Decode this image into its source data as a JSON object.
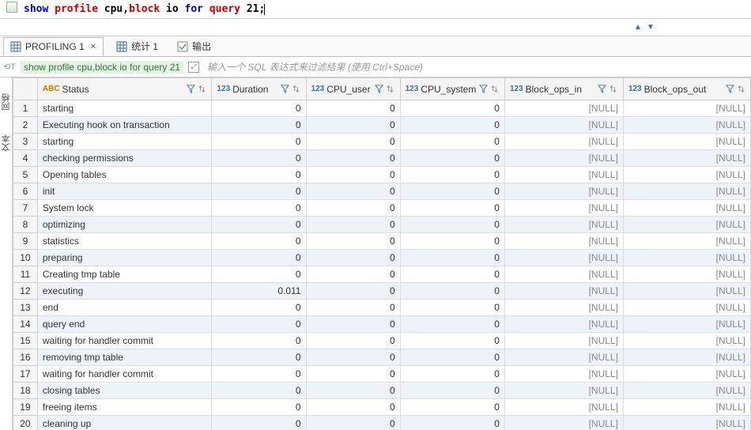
{
  "sql": {
    "text_parts": {
      "show": "show",
      "profile": "profile",
      "cpu": "cpu",
      "comma": ",",
      "block": "block",
      "io": "io",
      "for": "for",
      "query": "query",
      "num": "21",
      "semi": ";"
    }
  },
  "tabs": {
    "items": [
      {
        "label": "PROFILING 1",
        "active": true,
        "closable": true,
        "icon": "grid"
      },
      {
        "label": "统计 1",
        "active": false,
        "closable": false,
        "icon": "grid"
      },
      {
        "label": "输出",
        "active": false,
        "closable": false,
        "icon": "green"
      }
    ]
  },
  "filter": {
    "sql_text": "show profile cpu,block io for query 21",
    "placeholder": "输入一个 SQL 表达式来过滤结果 (使用 Ctrl+Space)"
  },
  "gutter": {
    "top": "网格",
    "bottom": "文本"
  },
  "columns": [
    {
      "name": "Status",
      "type": "ABC"
    },
    {
      "name": "Duration",
      "type": "123"
    },
    {
      "name": "CPU_user",
      "type": "123"
    },
    {
      "name": "CPU_system",
      "type": "123"
    },
    {
      "name": "Block_ops_in",
      "type": "123"
    },
    {
      "name": "Block_ops_out",
      "type": "123"
    }
  ],
  "nullText": "[NULL]",
  "rows": [
    {
      "n": 1,
      "status": "starting",
      "dur": "0",
      "cpuu": "0",
      "cpus": "0",
      "bin": null,
      "bout": null
    },
    {
      "n": 2,
      "status": "Executing hook on transaction",
      "dur": "0",
      "cpuu": "0",
      "cpus": "0",
      "bin": null,
      "bout": null
    },
    {
      "n": 3,
      "status": "starting",
      "dur": "0",
      "cpuu": "0",
      "cpus": "0",
      "bin": null,
      "bout": null
    },
    {
      "n": 4,
      "status": "checking permissions",
      "dur": "0",
      "cpuu": "0",
      "cpus": "0",
      "bin": null,
      "bout": null
    },
    {
      "n": 5,
      "status": "Opening tables",
      "dur": "0",
      "cpuu": "0",
      "cpus": "0",
      "bin": null,
      "bout": null
    },
    {
      "n": 6,
      "status": "init",
      "dur": "0",
      "cpuu": "0",
      "cpus": "0",
      "bin": null,
      "bout": null
    },
    {
      "n": 7,
      "status": "System lock",
      "dur": "0",
      "cpuu": "0",
      "cpus": "0",
      "bin": null,
      "bout": null
    },
    {
      "n": 8,
      "status": "optimizing",
      "dur": "0",
      "cpuu": "0",
      "cpus": "0",
      "bin": null,
      "bout": null
    },
    {
      "n": 9,
      "status": "statistics",
      "dur": "0",
      "cpuu": "0",
      "cpus": "0",
      "bin": null,
      "bout": null
    },
    {
      "n": 10,
      "status": "preparing",
      "dur": "0",
      "cpuu": "0",
      "cpus": "0",
      "bin": null,
      "bout": null
    },
    {
      "n": 11,
      "status": "Creating tmp table",
      "dur": "0",
      "cpuu": "0",
      "cpus": "0",
      "bin": null,
      "bout": null
    },
    {
      "n": 12,
      "status": "executing",
      "dur": "0.011",
      "cpuu": "0",
      "cpus": "0",
      "bin": null,
      "bout": null
    },
    {
      "n": 13,
      "status": "end",
      "dur": "0",
      "cpuu": "0",
      "cpus": "0",
      "bin": null,
      "bout": null
    },
    {
      "n": 14,
      "status": "query end",
      "dur": "0",
      "cpuu": "0",
      "cpus": "0",
      "bin": null,
      "bout": null
    },
    {
      "n": 15,
      "status": "waiting for handler commit",
      "dur": "0",
      "cpuu": "0",
      "cpus": "0",
      "bin": null,
      "bout": null
    },
    {
      "n": 16,
      "status": "removing tmp table",
      "dur": "0",
      "cpuu": "0",
      "cpus": "0",
      "bin": null,
      "bout": null
    },
    {
      "n": 17,
      "status": "waiting for handler commit",
      "dur": "0",
      "cpuu": "0",
      "cpus": "0",
      "bin": null,
      "bout": null
    },
    {
      "n": 18,
      "status": "closing tables",
      "dur": "0",
      "cpuu": "0",
      "cpus": "0",
      "bin": null,
      "bout": null
    },
    {
      "n": 19,
      "status": "freeing items",
      "dur": "0",
      "cpuu": "0",
      "cpus": "0",
      "bin": null,
      "bout": null
    },
    {
      "n": 20,
      "status": "cleaning up",
      "dur": "0",
      "cpuu": "0",
      "cpus": "0",
      "bin": null,
      "bout": null
    }
  ]
}
